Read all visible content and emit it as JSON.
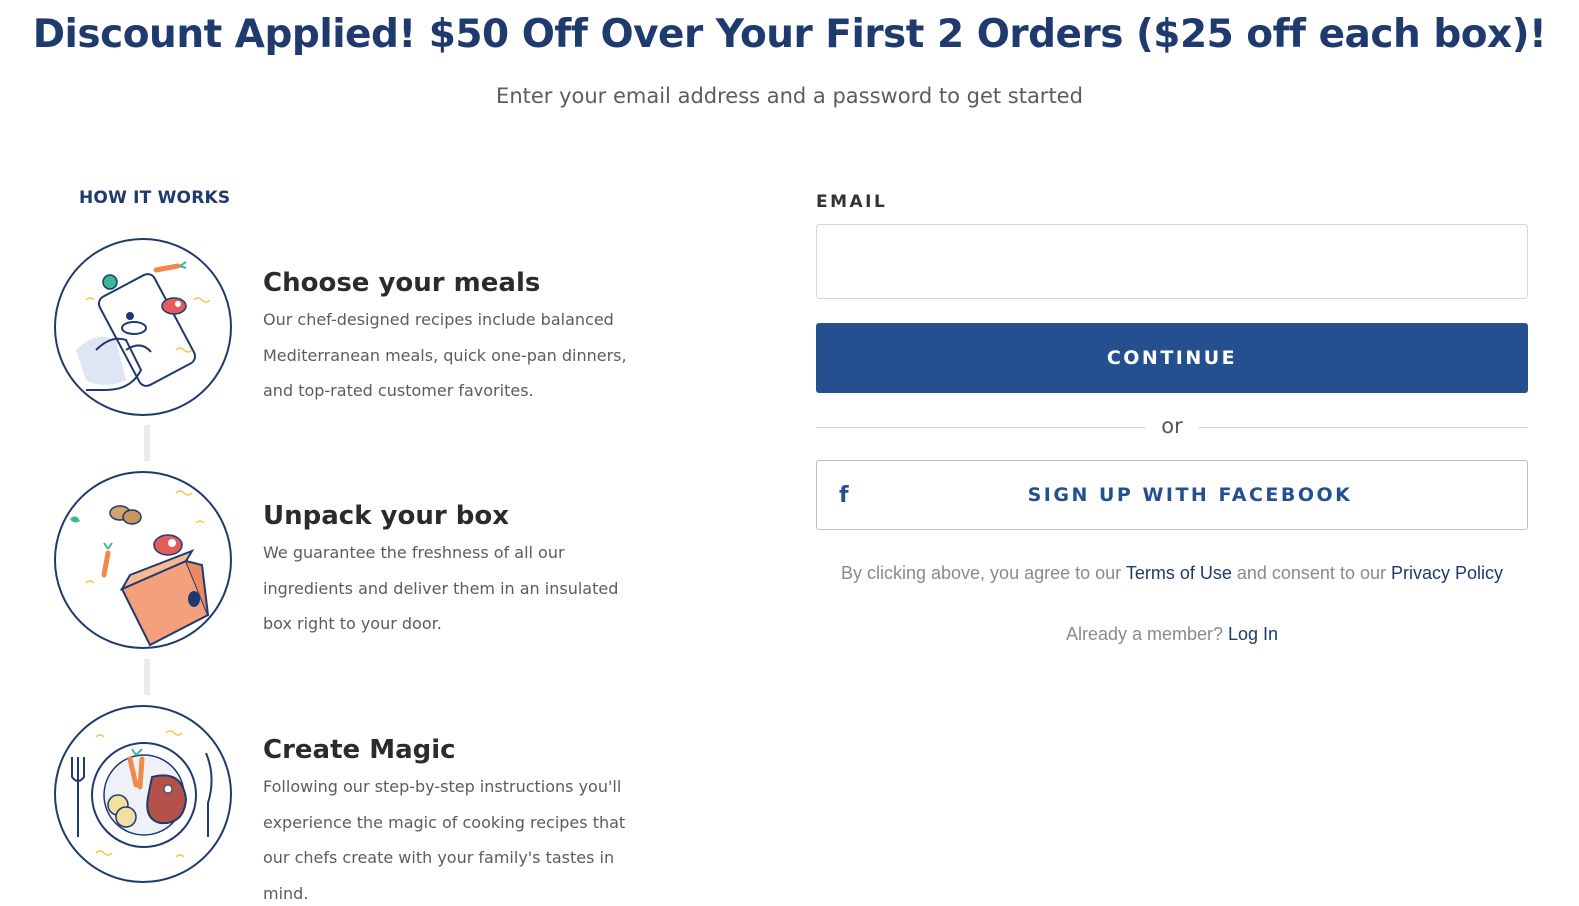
{
  "header": {
    "headline": "Discount Applied! $50 Off Over Your First 2 Orders ($25 off each box)!",
    "subhead": "Enter your email address and a password to get started"
  },
  "how_it_works": {
    "title": "HOW IT WORKS",
    "steps": [
      {
        "title": "Choose your meals",
        "description": "Our chef-designed recipes include balanced Mediterranean meals, quick one-pan dinners, and top-rated customer favorites.",
        "icon": "phone-meal-icon"
      },
      {
        "title": "Unpack your box",
        "description": "We guarantee the freshness of all our ingredients and deliver them in an insulated box right to your door.",
        "icon": "delivery-box-icon"
      },
      {
        "title": "Create Magic",
        "description": "Following our step-by-step instructions you'll experience the magic of cooking recipes that our chefs create with your family's tastes in mind.",
        "icon": "dinner-plate-icon"
      }
    ]
  },
  "signup": {
    "email_label": "EMAIL",
    "email_value": "",
    "continue_label": "CONTINUE",
    "or_text": "or",
    "facebook_icon": "f",
    "facebook_label": "SIGN UP WITH FACEBOOK",
    "legal_prefix": "By clicking above, you agree to our ",
    "terms_link": "Terms of Use",
    "legal_middle": " and consent to our ",
    "privacy_link": "Privacy Policy",
    "member_prefix": "Already a member? ",
    "login_link": "Log In"
  },
  "colors": {
    "brand_navy": "#1e3a6e",
    "button_blue": "#24508f",
    "accent_orange": "#f4a07c"
  }
}
